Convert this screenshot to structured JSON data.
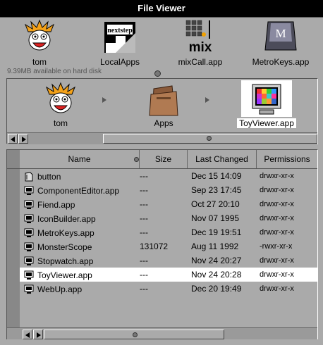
{
  "window": {
    "title": "File Viewer"
  },
  "shelf": {
    "items": [
      {
        "label": "tom",
        "icon": "calvin-face-icon"
      },
      {
        "label": "LocalApps",
        "icon": "nextstep-folder-icon"
      },
      {
        "label": "mixCall.app",
        "icon": "mix-app-icon"
      },
      {
        "label": "MetroKeys.app",
        "icon": "m-key-icon"
      }
    ],
    "disk_free": "9.39MB available on hard disk"
  },
  "browser": {
    "path": [
      {
        "label": "tom",
        "icon": "calvin-face-icon"
      },
      {
        "label": "Apps",
        "icon": "folder-icon"
      },
      {
        "label": "ToyViewer.app",
        "icon": "monitor-app-icon",
        "selected": true
      }
    ]
  },
  "list": {
    "columns": [
      "Name",
      "Size",
      "Last Changed",
      "Permissions"
    ],
    "rows": [
      {
        "name": "button",
        "size": "---",
        "date": "Dec 15 14:09",
        "perm": "drwxr-xr-x",
        "icon": "folder-doc-icon",
        "selected": false
      },
      {
        "name": "ComponentEditor.app",
        "size": "---",
        "date": "Sep 23 17:45",
        "perm": "drwxr-xr-x",
        "icon": "app-icon",
        "selected": false
      },
      {
        "name": "Fiend.app",
        "size": "---",
        "date": "Oct 27 20:10",
        "perm": "drwxr-xr-x",
        "icon": "app-icon",
        "selected": false
      },
      {
        "name": "IconBuilder.app",
        "size": "---",
        "date": "Nov 07 1995",
        "perm": "drwxr-xr-x",
        "icon": "app-icon",
        "selected": false
      },
      {
        "name": "MetroKeys.app",
        "size": "---",
        "date": "Dec 19 19:51",
        "perm": "drwxr-xr-x",
        "icon": "app-icon",
        "selected": false
      },
      {
        "name": "MonsterScope",
        "size": "131072",
        "date": "Aug 11 1992",
        "perm": "-rwxr-xr-x",
        "icon": "app-icon",
        "selected": false
      },
      {
        "name": "Stopwatch.app",
        "size": "---",
        "date": "Nov 24 20:27",
        "perm": "drwxr-xr-x",
        "icon": "app-icon",
        "selected": false
      },
      {
        "name": "ToyViewer.app",
        "size": "---",
        "date": "Nov 24 20:28",
        "perm": "drwxr-xr-x",
        "icon": "app-icon",
        "selected": true
      },
      {
        "name": "WebUp.app",
        "size": "---",
        "date": "Dec 20 19:49",
        "perm": "drwxr-xr-x",
        "icon": "app-icon",
        "selected": false
      }
    ]
  }
}
